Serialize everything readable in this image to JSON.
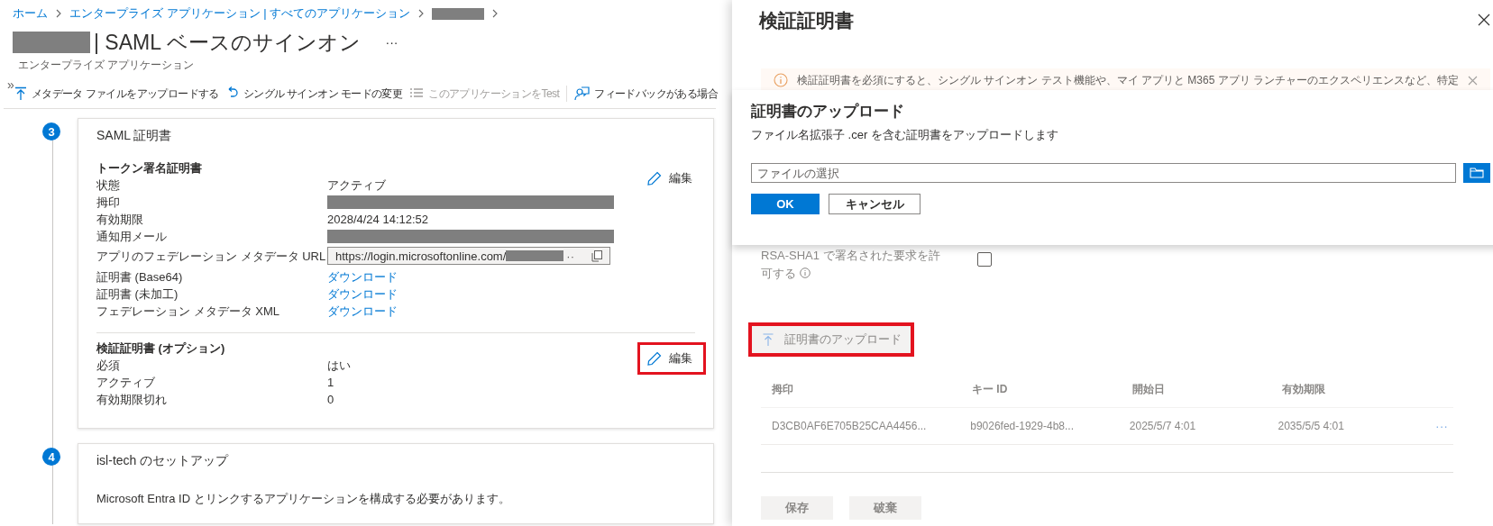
{
  "breadcrumb": [
    {
      "label": "ホーム"
    },
    {
      "label": "エンタープライズ アプリケーション | すべてのアプリケーション"
    }
  ],
  "page": {
    "title": "| SAML ベースのサインオン",
    "more": "···",
    "subtitle": "エンタープライズ アプリケーション",
    "collapse": "»"
  },
  "toolbar": [
    {
      "kind": "upload",
      "label": "メタデータ ファイルをアップロードする",
      "disabled": false
    },
    {
      "kind": "undo",
      "label": "シングル サインオン モードの変更",
      "disabled": false
    },
    {
      "kind": "test",
      "label": "このアプリケーションをTest",
      "disabled": true
    },
    {
      "kind": "feedback",
      "label": "フィードバックがある場合",
      "disabled": false
    }
  ],
  "steps": [
    {
      "number": "3",
      "title": "SAML 証明書",
      "sections": [
        {
          "heading": "トークン署名証明書",
          "edit": {
            "label": "編集",
            "highlighted": false
          },
          "rows": [
            {
              "label": "状態",
              "kind": "text",
              "value": "アクティブ"
            },
            {
              "label": "拇印",
              "kind": "redacted"
            },
            {
              "label": "有効期限",
              "kind": "text",
              "value": "2028/4/24 14:12:52"
            },
            {
              "label": "通知用メール",
              "kind": "redacted"
            },
            {
              "label": "アプリのフェデレーション メタデータ URL",
              "kind": "url",
              "value": "https://login.microsoftonline.com/",
              "ellipsis": "··"
            },
            {
              "label": "証明書 (Base64)",
              "kind": "link",
              "value": "ダウンロード"
            },
            {
              "label": "証明書 (未加工)",
              "kind": "link",
              "value": "ダウンロード"
            },
            {
              "label": "フェデレーション メタデータ XML",
              "kind": "link",
              "value": "ダウンロード"
            }
          ]
        },
        {
          "heading": "検証証明書 (オプション)",
          "edit": {
            "label": "編集",
            "highlighted": true
          },
          "rows": [
            {
              "label": "必須",
              "kind": "text",
              "value": "はい"
            },
            {
              "label": "アクティブ",
              "kind": "text",
              "value": "1"
            },
            {
              "label": "有効期限切れ",
              "kind": "text",
              "value": "0"
            }
          ]
        }
      ]
    },
    {
      "number": "4",
      "title": "isl-tech のセットアップ",
      "text": "Microsoft Entra ID とリンクするアプリケーションを構成する必要があります。"
    }
  ],
  "panel": {
    "title": "検証証明書",
    "notice": "検証証明書を必須にすると、シングル サインオン テスト機能や、マイ アプリと M365 アプリ ランチャーのエクスペリエンスなど、特定",
    "options": [
      {
        "label": "RSA-SHA1 で署名された要求を許可する",
        "checked": false
      }
    ],
    "upload_button": {
      "label": "証明書のアップロード",
      "highlighted": true
    },
    "table": {
      "columns": [
        "拇印",
        "キー ID",
        "開始日",
        "有効期限"
      ],
      "rows": [
        {
          "cells": [
            "D3CB0AF6E705B25CAA4456...",
            "b9026fed-1929-4b8...",
            "2025/5/7 4:01",
            "2035/5/5 4:01"
          ],
          "more": "···"
        }
      ]
    },
    "buttons": [
      {
        "label": "保存",
        "disabled": true
      },
      {
        "label": "破棄",
        "disabled": true
      }
    ]
  },
  "dialog": {
    "title": "証明書のアップロード",
    "description": "ファイル名拡張子 .cer を含む証明書をアップロードします",
    "file_field": {
      "placeholder": "ファイルの選択"
    },
    "buttons": [
      {
        "kind": "primary",
        "label": "OK"
      },
      {
        "kind": "secondary",
        "label": "キャンセル"
      }
    ]
  }
}
